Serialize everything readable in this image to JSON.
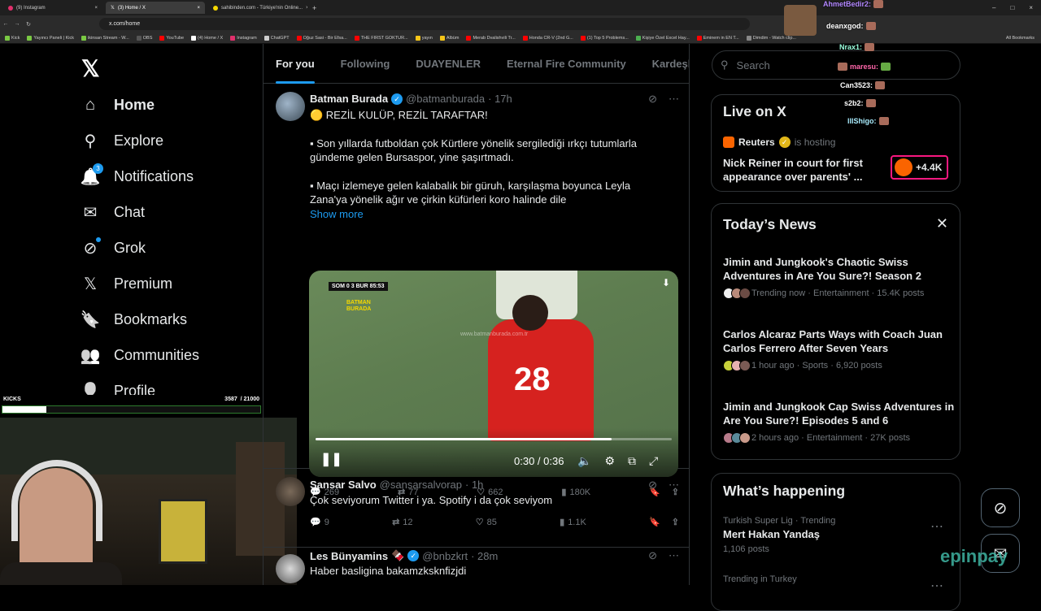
{
  "browser": {
    "tabs": [
      {
        "label": "(9) Instagram",
        "active": false
      },
      {
        "label": "(3) Home / X",
        "active": true
      },
      {
        "label": "sahibinden.com - Türkiye'nin Online...",
        "active": false
      }
    ],
    "url": "x.com/home",
    "bookmarks": [
      "Kick",
      "Yayıncı Paneli | Kick",
      "ikinsan Stream - W...",
      "OBS",
      "YouTube",
      "(4) Home / X",
      "Instagram",
      "ChatGPT",
      "Oğuz Sasi - Bir Efsa...",
      "THE FIRST GOKTUR...",
      "yayın",
      "Albüm",
      "Merab Dvalishvili Tr...",
      "Honda CR-V (2nd G...",
      "(1) Top 5 Problems...",
      "Kişiye Özel Excel Hay...",
      "Eminem in EN T...",
      "Dimdim - Watch clip..."
    ],
    "all_bookmarks": "All Bookmarks"
  },
  "nav": {
    "logo": "𝕏",
    "items": [
      {
        "label": "Home",
        "icon": "home-icon",
        "glyph": "⌂"
      },
      {
        "label": "Explore",
        "icon": "search-icon",
        "glyph": "⚲"
      },
      {
        "label": "Notifications",
        "icon": "bell-icon",
        "glyph": "🔔",
        "badge": "3"
      },
      {
        "label": "Chat",
        "icon": "mail-icon",
        "glyph": "✉"
      },
      {
        "label": "Grok",
        "icon": "grok-icon",
        "glyph": "⊘"
      },
      {
        "label": "Premium",
        "icon": "x-logo-icon",
        "glyph": "𝕏"
      },
      {
        "label": "Bookmarks",
        "icon": "bookmark-icon",
        "glyph": "🔖"
      },
      {
        "label": "Communities",
        "icon": "people-icon",
        "glyph": "👥"
      },
      {
        "label": "Profile",
        "icon": "person-icon",
        "glyph": "👤"
      }
    ]
  },
  "kicks": {
    "label": "KICKS",
    "count": "3587",
    "goal": "/ 21000",
    "progress": 0.17
  },
  "feed": {
    "tabs": [
      "For you",
      "Following",
      "DUAYENLER",
      "Eternal Fire Community",
      "Kardeşler Ki"
    ],
    "posts": [
      {
        "name": "Batman Burada",
        "handle": "@batmanburada",
        "time": "· 17h",
        "lines": [
          "🟡  REZİL KULÜP, REZİL TARAFTAR!",
          "",
          "▪  Son yıllarda futboldan çok Kürtlere yönelik sergilediği ırkçı tutumlarla gündeme gelen Bursaspor, yine şaşırtmadı.",
          "",
          "▪  Maçı izlemeye gelen kalabalık bir güruh, karşılaşma boyunca Leyla Zana'ya yönelik ağır ve çirkin küfürleri koro halinde dile"
        ],
        "show_more": "Show more",
        "video": {
          "score": "SOM 0 3 BUR 85:53",
          "watermark": "BATMAN BURADA",
          "site": "www.batmanburada.com.tr",
          "jersey": "28",
          "time": "0:30 / 0:36",
          "progress": 0.83
        },
        "replies": "269",
        "reposts": "77",
        "likes": "662",
        "views": "180K"
      },
      {
        "name": "Sansar Salvo",
        "handle": "@sansarsalvorap",
        "time": "· 1h",
        "lines": [
          "Çok seviyorum Twitter i ya. Spotify i da çok seviyom"
        ],
        "replies": "9",
        "reposts": "12",
        "likes": "85",
        "views": "1.1K"
      },
      {
        "name": "Les Bünyamins",
        "handle": "@bnbzkrt",
        "time": "· 28m",
        "lines": [
          "Haber basligina bakamzksknfizjdi"
        ]
      }
    ]
  },
  "right": {
    "search_placeholder": "Search",
    "live": {
      "title": "Live on X",
      "host": "Reuters",
      "hosting": "is hosting",
      "headline": "Nick Reiner in court for first appearance over parents' ...",
      "count": "+4.4K"
    },
    "todays_news": {
      "title": "Today’s News",
      "items": [
        {
          "title": "Jimin and Jungkook's Chaotic Swiss Adventures in Are You Sure?! Season 2",
          "meta": "Trending now · Entertainment · 15.4K posts"
        },
        {
          "title": "Carlos Alcaraz Parts Ways with Coach Juan Carlos Ferrero After Seven Years",
          "meta": "1 hour ago · Sports · 6,920 posts"
        },
        {
          "title": "Jimin and Jungkook Cap Swiss Adventures in Are You Sure?! Episodes 5 and 6",
          "meta": "2 hours ago · Entertainment · 27K posts"
        }
      ]
    },
    "happening": {
      "title": "What’s happening",
      "items": [
        {
          "context": "Turkish Super Lig · Trending",
          "topic": "Mert Hakan Yandaş",
          "posts": "1,106 posts"
        },
        {
          "context": "Trending in Turkey"
        }
      ]
    }
  },
  "chat_overlay": {
    "messages": [
      "AhmetBedir2:",
      "deanxgod:",
      "Nrax1:",
      "maresu:",
      "Can3523:",
      "s2b2:",
      "lllShigo:"
    ],
    "brand": "epinpay"
  }
}
